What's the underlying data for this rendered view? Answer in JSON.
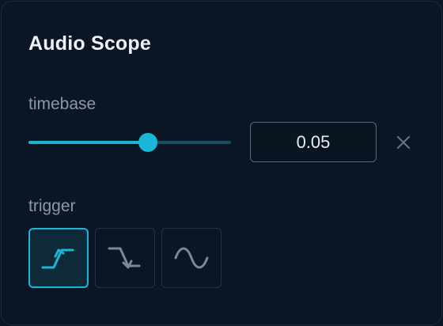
{
  "panel": {
    "title": "Audio Scope"
  },
  "timebase": {
    "label": "timebase",
    "value": "0.05",
    "slider_fraction": 0.59
  },
  "trigger": {
    "label": "trigger",
    "modes": [
      {
        "icon": "rising-edge-icon",
        "selected": true
      },
      {
        "icon": "falling-edge-icon",
        "selected": false
      },
      {
        "icon": "sine-wave-icon",
        "selected": false
      }
    ]
  },
  "colors": {
    "accent": "#1bb6d6",
    "track": "#16505e",
    "background": "#0b1624"
  }
}
